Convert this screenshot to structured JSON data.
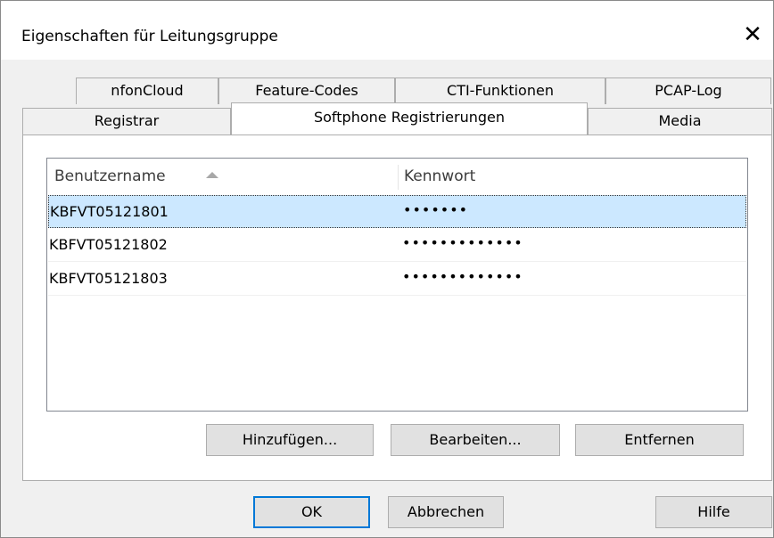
{
  "window": {
    "title": "Eigenschaften für Leitungsgruppe",
    "close_glyph": "✕"
  },
  "tabs_row1": [
    {
      "label": "nfonCloud"
    },
    {
      "label": "Feature-Codes"
    },
    {
      "label": "CTI-Funktionen"
    },
    {
      "label": "PCAP-Log"
    }
  ],
  "tabs_row2": [
    {
      "label": "Registrar"
    },
    {
      "label": "Softphone Registrierungen",
      "active": true
    },
    {
      "label": "Media"
    }
  ],
  "list": {
    "columns": [
      "Benutzername",
      "Kennwort"
    ],
    "sort": "ascending",
    "rows": [
      {
        "user": "KBFVT05121801",
        "password": "•••••••",
        "selected": true
      },
      {
        "user": "KBFVT05121802",
        "password": "•••••••••••••"
      },
      {
        "user": "KBFVT05121803",
        "password": "•••••••••••••"
      }
    ]
  },
  "actions": {
    "add": "Hinzufügen...",
    "edit": "Bearbeiten...",
    "remove": "Entfernen"
  },
  "footer": {
    "ok": "OK",
    "cancel": "Abbrechen",
    "help": "Hilfe"
  },
  "colors": {
    "selection": "#cce8ff",
    "default_button_border": "#0078d7"
  }
}
